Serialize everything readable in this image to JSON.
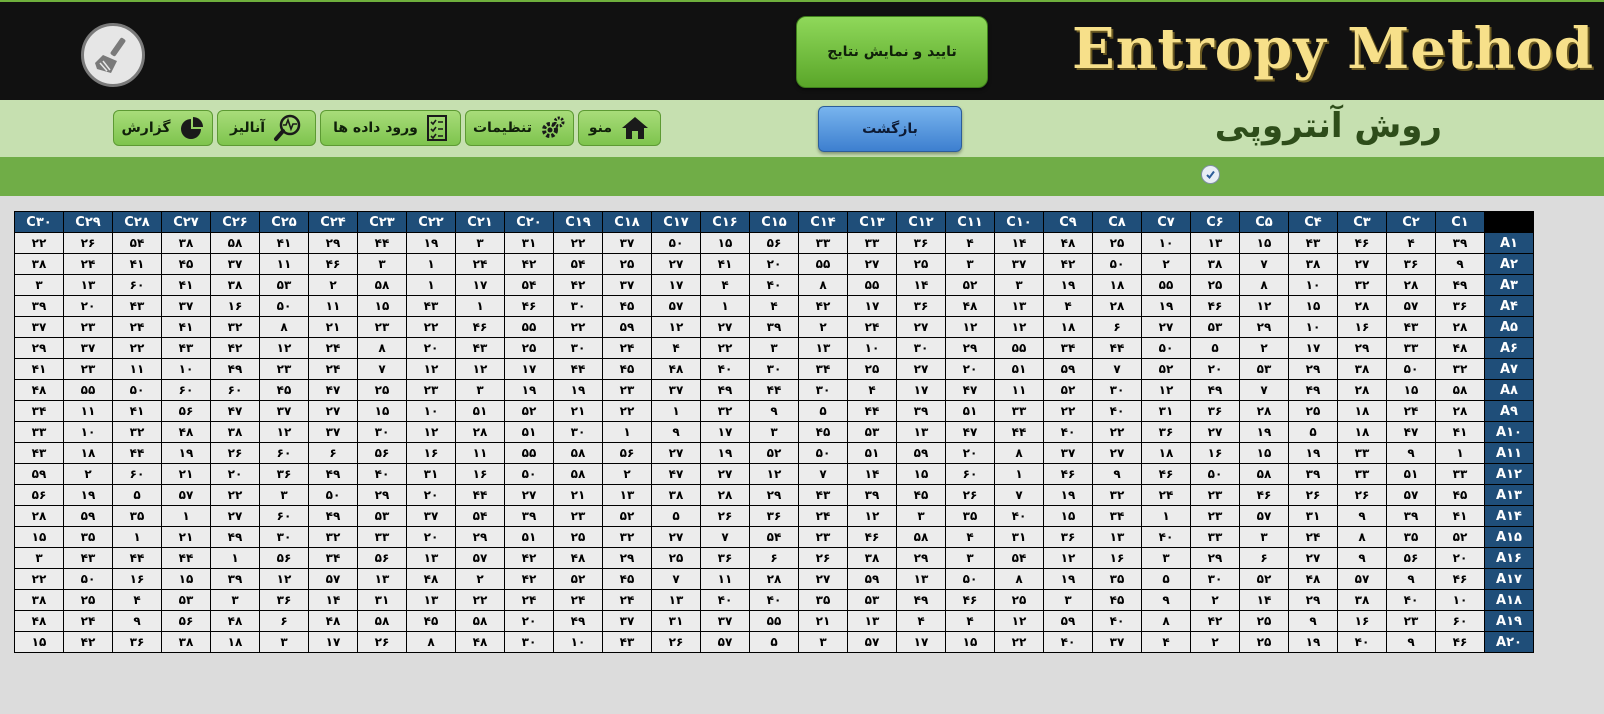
{
  "app_title": "Entropy Method",
  "page_title": "روش آنتروپی",
  "toolbar": {
    "confirm_label": "تایید و نمایش نتایج",
    "back_label": "بازگشت"
  },
  "nav": [
    {
      "label": "منو",
      "icon": "home-icon"
    },
    {
      "label": "تنظیمات",
      "icon": "gear-icon"
    },
    {
      "label": "ورود داده ها",
      "icon": "checklist-icon"
    },
    {
      "label": "آنالیز",
      "icon": "magnifier-chart-icon"
    },
    {
      "label": "گزارش",
      "icon": "pie-chart-icon"
    }
  ],
  "colors": {
    "header_bg": "#111111",
    "title_gold": "#f7e08a",
    "nav_bg": "#c6e0b0",
    "green_strip": "#70ad47",
    "table_header": "#1f4e79"
  },
  "table": {
    "columns": [
      "C۱",
      "C۲",
      "C۳",
      "C۴",
      "C۵",
      "C۶",
      "C۷",
      "C۸",
      "C۹",
      "C۱۰",
      "C۱۱",
      "C۱۲",
      "C۱۳",
      "C۱۴",
      "C۱۵",
      "C۱۶",
      "C۱۷",
      "C۱۸",
      "C۱۹",
      "C۲۰",
      "C۲۱",
      "C۲۲",
      "C۲۳",
      "C۲۴",
      "C۲۵",
      "C۲۶",
      "C۲۷",
      "C۲۸",
      "C۲۹",
      "C۳۰"
    ],
    "rows": [
      {
        "label": "A۱",
        "values": [
          "۳۹",
          "۴",
          "۴۶",
          "۴۳",
          "۱۵",
          "۱۳",
          "۱۰",
          "۲۵",
          "۴۸",
          "۱۴",
          "۴",
          "۳۶",
          "۳۳",
          "۳۳",
          "۵۶",
          "۱۵",
          "۵۰",
          "۳۷",
          "۲۲",
          "۳۱",
          "۳",
          "۱۹",
          "۴۴",
          "۲۹",
          "۴۱",
          "۵۸",
          "۳۸",
          "۵۴",
          "۲۶",
          "۲۲"
        ]
      },
      {
        "label": "A۲",
        "values": [
          "۹",
          "۳۶",
          "۲۷",
          "۳۸",
          "۷",
          "۳۸",
          "۲",
          "۵۰",
          "۴۲",
          "۳۷",
          "۳",
          "۲۵",
          "۲۷",
          "۵۵",
          "۲۰",
          "۴۱",
          "۲۷",
          "۲۵",
          "۵۴",
          "۴۲",
          "۲۴",
          "۱",
          "۳",
          "۴۶",
          "۱۱",
          "۳۷",
          "۴۵",
          "۴۱",
          "۲۴",
          "۳۸"
        ]
      },
      {
        "label": "A۳",
        "values": [
          "۴۹",
          "۲۸",
          "۳۲",
          "۱۰",
          "۸",
          "۲۵",
          "۵۵",
          "۱۸",
          "۱۹",
          "۳",
          "۵۲",
          "۱۴",
          "۵۵",
          "۸",
          "۴۰",
          "۴",
          "۱۷",
          "۳۷",
          "۴۲",
          "۵۴",
          "۱۷",
          "۱",
          "۵۸",
          "۲",
          "۵۳",
          "۳۸",
          "۴۱",
          "۶۰",
          "۱۳",
          "۳"
        ]
      },
      {
        "label": "A۴",
        "values": [
          "۳۶",
          "۵۷",
          "۲۸",
          "۱۵",
          "۱۲",
          "۴۶",
          "۱۹",
          "۲۸",
          "۴",
          "۱۳",
          "۴۸",
          "۳۶",
          "۱۷",
          "۴۲",
          "۴",
          "۱",
          "۵۷",
          "۴۵",
          "۳۰",
          "۴۶",
          "۱",
          "۴۳",
          "۱۵",
          "۱۱",
          "۵۰",
          "۱۶",
          "۳۷",
          "۴۳",
          "۲۰",
          "۳۹"
        ]
      },
      {
        "label": "A۵",
        "values": [
          "۲۸",
          "۴۳",
          "۱۶",
          "۱۰",
          "۲۹",
          "۵۳",
          "۲۷",
          "۶",
          "۱۸",
          "۱۲",
          "۱۲",
          "۲۷",
          "۲۴",
          "۲",
          "۳۹",
          "۲۷",
          "۱۲",
          "۵۹",
          "۲۲",
          "۵۵",
          "۴۶",
          "۲۲",
          "۲۳",
          "۲۱",
          "۸",
          "۳۲",
          "۴۱",
          "۲۴",
          "۲۳",
          "۳۷"
        ]
      },
      {
        "label": "A۶",
        "values": [
          "۴۸",
          "۳۳",
          "۲۹",
          "۱۷",
          "۲",
          "۵",
          "۵۰",
          "۴۴",
          "۳۴",
          "۵۵",
          "۲۹",
          "۳۰",
          "۱۰",
          "۱۳",
          "۳",
          "۲۲",
          "۴",
          "۲۴",
          "۳۰",
          "۲۵",
          "۴۳",
          "۲۰",
          "۸",
          "۲۴",
          "۱۲",
          "۴۲",
          "۴۳",
          "۲۲",
          "۳۷",
          "۲۹"
        ]
      },
      {
        "label": "A۷",
        "values": [
          "۳۲",
          "۵۰",
          "۳۸",
          "۲۹",
          "۵۳",
          "۲۰",
          "۵۲",
          "۷",
          "۵۹",
          "۵۱",
          "۲۰",
          "۲۷",
          "۲۵",
          "۳۴",
          "۳۰",
          "۴۰",
          "۴۸",
          "۴۵",
          "۴۴",
          "۱۷",
          "۱۲",
          "۱۲",
          "۷",
          "۲۴",
          "۲۳",
          "۴۹",
          "۱۰",
          "۱۱",
          "۲۳",
          "۴۱"
        ]
      },
      {
        "label": "A۸",
        "values": [
          "۵۸",
          "۱۵",
          "۲۸",
          "۴۹",
          "۷",
          "۴۹",
          "۱۲",
          "۳۰",
          "۵۲",
          "۱۱",
          "۴۷",
          "۱۷",
          "۴",
          "۳۰",
          "۴۴",
          "۴۹",
          "۳۷",
          "۲۳",
          "۱۹",
          "۱۹",
          "۳",
          "۲۳",
          "۲۵",
          "۴۷",
          "۴۵",
          "۶۰",
          "۶۰",
          "۵۰",
          "۵۵",
          "۴۸"
        ]
      },
      {
        "label": "A۹",
        "values": [
          "۲۸",
          "۲۴",
          "۱۸",
          "۲۵",
          "۲۸",
          "۳۶",
          "۳۱",
          "۴۰",
          "۲۲",
          "۳۳",
          "۵۱",
          "۳۹",
          "۴۴",
          "۵",
          "۹",
          "۳۲",
          "۱",
          "۲۲",
          "۲۱",
          "۵۲",
          "۵۱",
          "۱۰",
          "۱۵",
          "۲۷",
          "۳۷",
          "۴۷",
          "۵۶",
          "۴۱",
          "۱۱",
          "۳۴"
        ]
      },
      {
        "label": "A۱۰",
        "values": [
          "۴۱",
          "۴۷",
          "۱۸",
          "۵",
          "۱۹",
          "۲۷",
          "۳۶",
          "۲۲",
          "۴۰",
          "۴۴",
          "۴۷",
          "۱۳",
          "۵۳",
          "۴۵",
          "۳",
          "۱۷",
          "۹",
          "۱",
          "۳۰",
          "۵۱",
          "۲۸",
          "۱۲",
          "۳۰",
          "۳۷",
          "۱۲",
          "۳۸",
          "۴۸",
          "۳۲",
          "۱۰",
          "۳۳"
        ]
      },
      {
        "label": "A۱۱",
        "values": [
          "۱",
          "۹",
          "۳۳",
          "۱۹",
          "۱۵",
          "۱۶",
          "۱۸",
          "۲۷",
          "۳۷",
          "۸",
          "۲۰",
          "۵۹",
          "۵۱",
          "۵۰",
          "۵۲",
          "۱۹",
          "۲۷",
          "۵۶",
          "۵۸",
          "۵۵",
          "۱۱",
          "۱۶",
          "۵۶",
          "۶",
          "۶۰",
          "۲۶",
          "۱۹",
          "۴۴",
          "۱۸",
          "۴۳"
        ]
      },
      {
        "label": "A۱۲",
        "values": [
          "۳۳",
          "۵۱",
          "۳۳",
          "۳۹",
          "۵۸",
          "۵۰",
          "۴۶",
          "۹",
          "۴۶",
          "۱",
          "۶۰",
          "۱۵",
          "۱۴",
          "۷",
          "۱۲",
          "۲۷",
          "۴۷",
          "۲",
          "۵۸",
          "۵۰",
          "۱۶",
          "۳۱",
          "۴۰",
          "۴۹",
          "۳۶",
          "۲۰",
          "۲۱",
          "۶۰",
          "۲",
          "۵۹"
        ]
      },
      {
        "label": "A۱۳",
        "values": [
          "۴۵",
          "۵۷",
          "۲۶",
          "۲۶",
          "۴۶",
          "۲۳",
          "۲۴",
          "۳۲",
          "۱۹",
          "۷",
          "۲۶",
          "۴۵",
          "۳۹",
          "۴۳",
          "۲۹",
          "۲۸",
          "۳۸",
          "۱۳",
          "۲۱",
          "۲۷",
          "۴۴",
          "۲۰",
          "۲۹",
          "۵۰",
          "۳",
          "۲۲",
          "۵۷",
          "۵",
          "۱۹",
          "۵۶"
        ]
      },
      {
        "label": "A۱۴",
        "values": [
          "۴۱",
          "۳۹",
          "۹",
          "۳۱",
          "۵۷",
          "۲۳",
          "۱",
          "۳۴",
          "۱۵",
          "۴۰",
          "۳۵",
          "۳",
          "۱۲",
          "۲۴",
          "۳۶",
          "۲۶",
          "۵",
          "۵۲",
          "۲۳",
          "۳۹",
          "۵۴",
          "۳۷",
          "۵۳",
          "۴۹",
          "۶۰",
          "۲۷",
          "۱",
          "۳۵",
          "۵۹",
          "۲۸"
        ]
      },
      {
        "label": "A۱۵",
        "values": [
          "۵۲",
          "۳۵",
          "۸",
          "۲۴",
          "۳",
          "۳۳",
          "۴۰",
          "۱۳",
          "۳۶",
          "۳۱",
          "۴",
          "۵۸",
          "۴۶",
          "۲۳",
          "۵۴",
          "۷",
          "۲۷",
          "۳۲",
          "۲۵",
          "۵۱",
          "۲۹",
          "۲۰",
          "۳۳",
          "۳۲",
          "۳۰",
          "۴۹",
          "۲۱",
          "۱",
          "۳۵",
          "۱۵"
        ]
      },
      {
        "label": "A۱۶",
        "values": [
          "۲۰",
          "۵۶",
          "۹",
          "۲۷",
          "۶",
          "۲۹",
          "۳",
          "۱۶",
          "۱۲",
          "۵۴",
          "۳",
          "۲۹",
          "۳۸",
          "۲۶",
          "۶",
          "۳۶",
          "۲۵",
          "۲۹",
          "۴۸",
          "۴۲",
          "۵۷",
          "۱۳",
          "۵۶",
          "۳۴",
          "۵۶",
          "۱",
          "۴۴",
          "۴۴",
          "۴۳",
          "۳"
        ]
      },
      {
        "label": "A۱۷",
        "values": [
          "۴۶",
          "۹",
          "۵۷",
          "۴۸",
          "۵۲",
          "۳۰",
          "۵",
          "۳۵",
          "۱۹",
          "۸",
          "۵۰",
          "۱۳",
          "۵۹",
          "۲۷",
          "۲۸",
          "۱۱",
          "۷",
          "۴۵",
          "۵۲",
          "۴۲",
          "۲",
          "۴۸",
          "۱۳",
          "۵۷",
          "۱۲",
          "۳۹",
          "۱۵",
          "۱۶",
          "۵۰",
          "۲۲"
        ]
      },
      {
        "label": "A۱۸",
        "values": [
          "۱۰",
          "۴۰",
          "۳۸",
          "۲۹",
          "۱۴",
          "۲",
          "۹",
          "۴۵",
          "۳",
          "۲۵",
          "۴۶",
          "۴۹",
          "۵۳",
          "۳۵",
          "۴۰",
          "۴۰",
          "۱۳",
          "۲۴",
          "۲۴",
          "۲۴",
          "۲۲",
          "۱۳",
          "۳۱",
          "۱۴",
          "۳۶",
          "۳",
          "۵۳",
          "۴",
          "۲۵",
          "۳۸"
        ]
      },
      {
        "label": "A۱۹",
        "values": [
          "۶۰",
          "۲۳",
          "۱۶",
          "۹",
          "۲۵",
          "۴۲",
          "۸",
          "۴۰",
          "۵۹",
          "۱۲",
          "۴",
          "۴",
          "۱۳",
          "۲۱",
          "۵۵",
          "۳۷",
          "۳۱",
          "۳۷",
          "۴۹",
          "۲۰",
          "۵۸",
          "۴۵",
          "۵۸",
          "۴۸",
          "۶",
          "۴۸",
          "۵۶",
          "۹",
          "۲۴",
          "۴۸"
        ]
      },
      {
        "label": "A۲۰",
        "values": [
          "۴۶",
          "۹",
          "۴۰",
          "۱۹",
          "۲۵",
          "۲",
          "۴",
          "۳۷",
          "۴۰",
          "۲۲",
          "۱۵",
          "۱۷",
          "۵۷",
          "۳",
          "۵",
          "۵۷",
          "۲۶",
          "۴۳",
          "۱۰",
          "۳۰",
          "۴۸",
          "۸",
          "۲۶",
          "۱۷",
          "۳",
          "۱۸",
          "۳۸",
          "۳۶",
          "۴۲",
          "۱۵"
        ]
      }
    ]
  }
}
